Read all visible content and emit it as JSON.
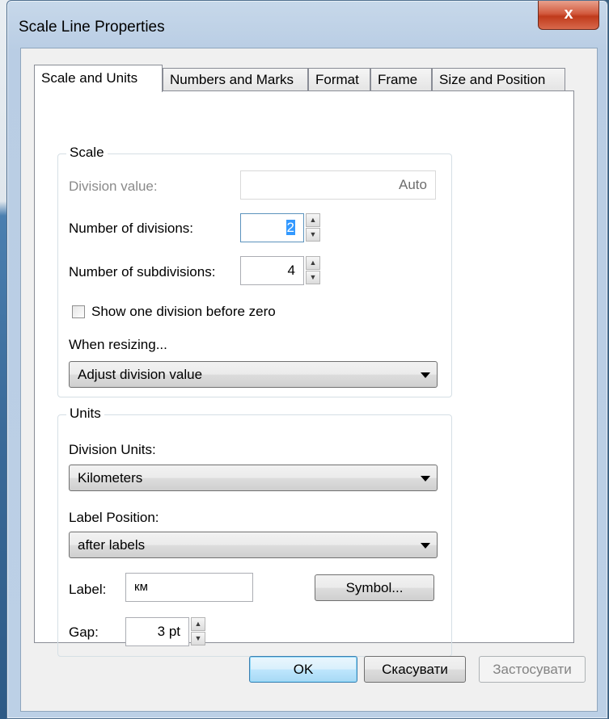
{
  "window": {
    "title": "Scale Line Properties",
    "close_glyph": "x"
  },
  "tabs": [
    {
      "label": "Scale and Units",
      "active": true
    },
    {
      "label": "Numbers and Marks",
      "active": false
    },
    {
      "label": "Format",
      "active": false
    },
    {
      "label": "Frame",
      "active": false
    },
    {
      "label": "Size and Position",
      "active": false
    }
  ],
  "scale": {
    "group_label": "Scale",
    "division_value_label": "Division value:",
    "division_value": "Auto",
    "num_divisions_label": "Number of divisions:",
    "num_divisions_value": "2",
    "num_subdivisions_label": "Number of subdivisions:",
    "num_subdivisions_value": "4",
    "show_one_division_label": "Show one division before zero",
    "show_one_division_checked": false,
    "when_resizing_label": "When resizing...",
    "when_resizing_value": "Adjust division value"
  },
  "units": {
    "group_label": "Units",
    "division_units_label": "Division Units:",
    "division_units_value": "Kilometers",
    "label_position_label": "Label Position:",
    "label_position_value": "after labels",
    "label_label": "Label:",
    "label_value": "км",
    "symbol_button": "Symbol...",
    "gap_label": "Gap:",
    "gap_value": "3 pt"
  },
  "footer": {
    "ok": "OK",
    "cancel": "Скасувати",
    "apply": "Застосувати"
  },
  "icons": [
    "close-icon",
    "spin-up-icon",
    "spin-down-icon",
    "dropdown-caret-icon"
  ]
}
